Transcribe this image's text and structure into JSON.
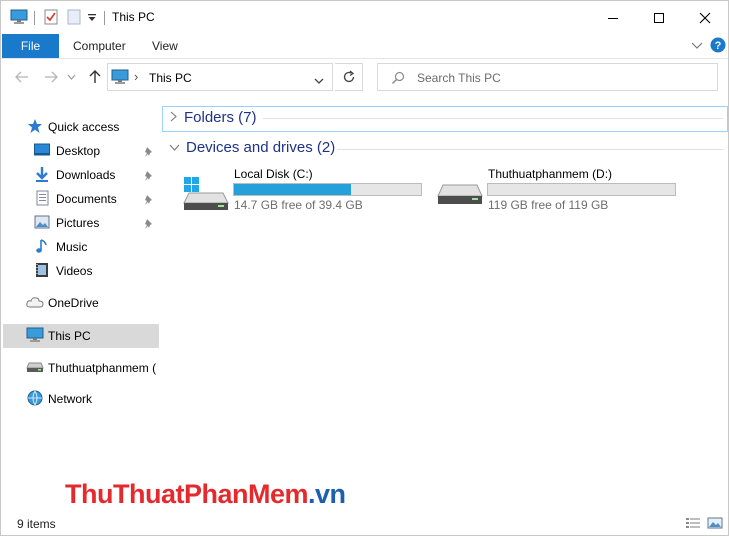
{
  "window": {
    "title": "This PC"
  },
  "ribbon": {
    "tabs": [
      {
        "label": "File"
      },
      {
        "label": "Computer"
      },
      {
        "label": "View"
      }
    ]
  },
  "address_bar": {
    "path": "This PC",
    "separator": "›"
  },
  "search": {
    "placeholder": "Search This PC"
  },
  "nav_pane": {
    "items": [
      {
        "label": "Quick access",
        "icon": "star-icon"
      },
      {
        "label": "Desktop",
        "icon": "desktop-icon",
        "pinned": true
      },
      {
        "label": "Downloads",
        "icon": "download-icon",
        "pinned": true
      },
      {
        "label": "Documents",
        "icon": "documents-icon",
        "pinned": true
      },
      {
        "label": "Pictures",
        "icon": "pictures-icon",
        "pinned": true
      },
      {
        "label": "Music",
        "icon": "music-icon"
      },
      {
        "label": "Videos",
        "icon": "videos-icon"
      },
      {
        "label": "OneDrive",
        "icon": "cloud-icon"
      },
      {
        "label": "This PC",
        "icon": "computer-icon",
        "selected": true
      },
      {
        "label": "Thuthuatphanmem (",
        "icon": "drive-icon"
      },
      {
        "label": "Network",
        "icon": "network-icon"
      }
    ]
  },
  "content": {
    "folders_group": {
      "label": "Folders (7)"
    },
    "drives_group": {
      "label": "Devices and drives (2)"
    },
    "drives": [
      {
        "name": "Local Disk (C:)",
        "free": "14.7 GB free of 39.4 GB",
        "used_fraction": 0.627,
        "windows_drive": true
      },
      {
        "name": "Thuthuatphanmem (D:)",
        "free": "119 GB free of 119 GB",
        "used_fraction": 0.0,
        "windows_drive": false
      }
    ]
  },
  "watermark": {
    "part1": "Thu",
    "part2": "Thuat",
    "part3": "PhanMem",
    "part4": ".vn"
  },
  "status_bar": {
    "items_count": "9 items"
  },
  "colors": {
    "accent": "#1979ca",
    "drive_bar_fill": "#26a0da",
    "group_header": "#1e3287",
    "watermark_red": "#e52a2e",
    "watermark_blue": "#1c5fae"
  }
}
